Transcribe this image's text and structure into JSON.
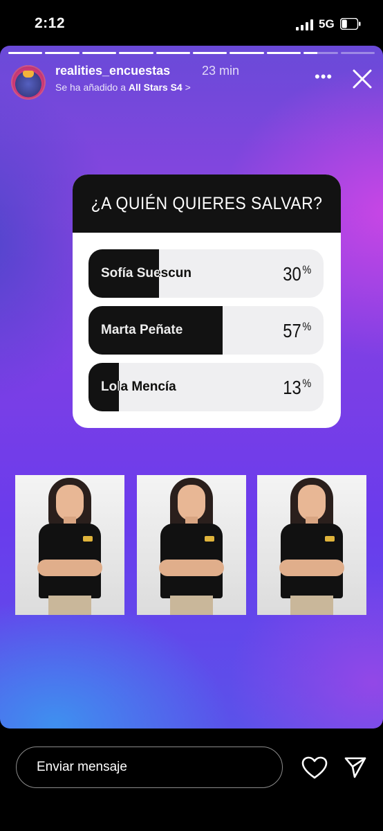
{
  "status_bar": {
    "time": "2:12",
    "network": "5G",
    "battery_level": 0.35
  },
  "story": {
    "progress_segments": 10,
    "progress_complete": 8,
    "progress_current_fraction": 0.4,
    "username": "realities_encuestas",
    "time_ago": "23 min",
    "added_prefix": "Se ha añadido a",
    "highlight_name": "All Stars S4",
    "chevron": ">",
    "more_icon": "more-horizontal-icon",
    "close_icon": "close-icon"
  },
  "poll": {
    "question": "¿A QUIÉN QUIERES SALVAR?",
    "options": [
      {
        "name": "Sofía Suescun",
        "percent": 30,
        "percent_text": "30",
        "symbol": "%"
      },
      {
        "name": "Marta Peñate",
        "percent": 57,
        "percent_text": "57",
        "symbol": "%"
      },
      {
        "name": "Lola Mencía",
        "percent": 13,
        "percent_text": "13",
        "symbol": "%"
      }
    ]
  },
  "photos": [
    "contestant-photo-1",
    "contestant-photo-2",
    "contestant-photo-3"
  ],
  "reply_bar": {
    "placeholder": "Enviar mensaje",
    "like_icon": "heart-icon",
    "send_icon": "send-icon"
  }
}
